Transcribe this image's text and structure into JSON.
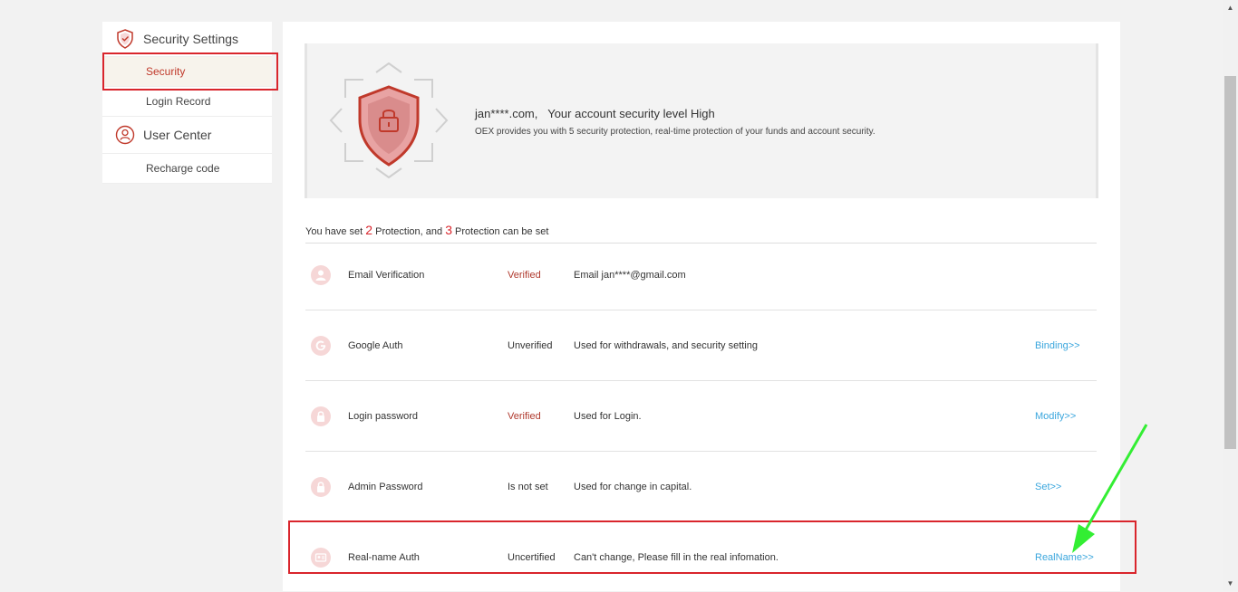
{
  "sidebar": {
    "groups": [
      {
        "label": "Security Settings",
        "icon": "shield-check-icon",
        "items": [
          "Security",
          "Login Record"
        ]
      },
      {
        "label": "User Center",
        "icon": "user-icon",
        "items": [
          "Recharge code"
        ]
      }
    ],
    "active_item": "Security"
  },
  "banner": {
    "account": "jan****.com,",
    "level_text": "Your account security level High",
    "description": "OEX provides you with 5 security protection, real-time protection of your funds and account security."
  },
  "summary": {
    "prefix": "You have set",
    "set_count": "2",
    "middle": "Protection, and",
    "remaining_count": "3",
    "suffix": "Protection can be set"
  },
  "rows": [
    {
      "name": "Email Verification",
      "status": "Verified",
      "desc": "Email jan****@gmail.com",
      "action": "",
      "icon": "user-icon"
    },
    {
      "name": "Google Auth",
      "status": "Unverified",
      "desc": "Used for withdrawals, and security setting",
      "action": "Binding>>",
      "icon": "google-icon"
    },
    {
      "name": "Login password",
      "status": "Verified",
      "desc": "Used for Login.",
      "action": "Modify>>",
      "icon": "lock-icon"
    },
    {
      "name": "Admin Password",
      "status": "Is not set",
      "desc": "Used for change in capital.",
      "action": "Set>>",
      "icon": "lock-icon"
    },
    {
      "name": "Real-name Auth",
      "status": "Uncertified",
      "desc": "Can't change, Please fill in the real infomation.",
      "action": "RealName>>",
      "icon": "id-card-icon"
    }
  ],
  "colors": {
    "accent": "#d9252c",
    "link": "#3aa6dd",
    "verified": "#b03a2e",
    "annotation_arrow": "#33ee33"
  }
}
